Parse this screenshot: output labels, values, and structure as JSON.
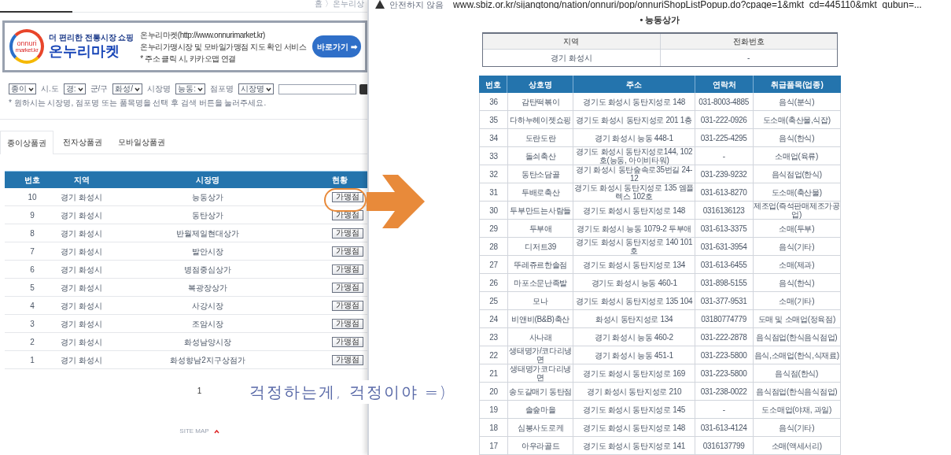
{
  "address_bar": {
    "security": "안전하지 않음",
    "url": "www.sbiz.or.kr/sijangtong/nation/onnuri/pop/onnuriShopListPopup.do?cpage=1&mkt_cd=445110&mkt_gubun=..."
  },
  "left_page": {
    "breadcrumb": "홈 〉온누리상",
    "banner": {
      "logo_text": [
        "onnuri",
        "market.kr"
      ],
      "tagline": "더 편리한 전통시장 쇼핑",
      "brand": "온누리마켓",
      "lines": [
        "온누리마켓(http://www.onnurimarket.kr)",
        "온누리가맹시장 및 모바일가맹점 지도 확인 서비스",
        "* 주소 클릭 시, 카카오맵 연결"
      ],
      "button": "바로가기 ➡"
    },
    "filters": [
      {
        "kind": "select",
        "value": "종이"
      },
      {
        "kind": "label",
        "text": "시.도"
      },
      {
        "kind": "select",
        "value": "경:"
      },
      {
        "kind": "label",
        "text": "군/구"
      },
      {
        "kind": "select",
        "value": "화성/"
      },
      {
        "kind": "label",
        "text": "시장명"
      },
      {
        "kind": "select",
        "value": "능동:"
      },
      {
        "kind": "label",
        "text": "점포명"
      },
      {
        "kind": "select",
        "value": "시장명"
      },
      {
        "kind": "input"
      }
    ],
    "note": "* 원하시는 시장명, 점포명 또는 품목명을 선택 후 검색 버튼을 눌러주세요.",
    "tabs": [
      {
        "label": "종이상품권",
        "selected": true
      },
      {
        "label": "전자상품권",
        "selected": false
      },
      {
        "label": "모바일상품권",
        "selected": false
      }
    ],
    "table": {
      "columns": [
        "번호",
        "지역",
        "시장명",
        "현황"
      ],
      "rows": [
        [
          "10",
          "경기 화성시",
          "능동상가",
          "가맹점"
        ],
        [
          "9",
          "경기 화성시",
          "동탄상가",
          "가맹점"
        ],
        [
          "8",
          "경기 화성시",
          "반월제일현대상가",
          "가맹점"
        ],
        [
          "7",
          "경기 화성시",
          "발안시장",
          "가맹점"
        ],
        [
          "6",
          "경기 화성시",
          "병점중심상가",
          "가맹점"
        ],
        [
          "5",
          "경기 화성시",
          "복광장상가",
          "가맹점"
        ],
        [
          "4",
          "경기 화성시",
          "사강시장",
          "가맹점"
        ],
        [
          "3",
          "경기 화성시",
          "조암시장",
          "가맹점"
        ],
        [
          "2",
          "경기 화성시",
          "화성남양시장",
          "가맹점"
        ],
        [
          "1",
          "경기 화성시",
          "화성향남2지구상점가",
          "가맹점"
        ]
      ]
    },
    "pagination": [
      "1"
    ],
    "footer": "SITE MAP"
  },
  "popup": {
    "title": "• 능동상가",
    "info": {
      "columns": [
        "지역",
        "전화번호"
      ],
      "values": [
        "경기 화성시",
        "-"
      ]
    },
    "shops": {
      "columns": [
        "번호",
        "상호명",
        "주소",
        "연락처",
        "취급품목(업종)"
      ],
      "rows": [
        [
          "36",
          "감탄떡볶이",
          "경기도 화성시 동탄지성로 148",
          "031-8003-4885",
          "음식(분식)"
        ],
        [
          "35",
          "다하누헤이젯쇼핑",
          "경기도 화성시 동탄지성로 201 1층",
          "031-222-0926",
          "도소매(축산물,식잡)"
        ],
        [
          "34",
          "도란도란",
          "경기 화성시 능동 448-1",
          "031-225-4295",
          "음식(한식)"
        ],
        [
          "33",
          "돌쇠축산",
          "경기도 화성시 동탄지성로144, 102호(능동, 아이비타워)",
          "-",
          "소매업(육류)"
        ],
        [
          "32",
          "동탄소담골",
          "경기 화성시 동탄숲속로35번길 24-12",
          "031-239-9232",
          "음식점업(한식)"
        ],
        [
          "31",
          "두배로축산",
          "경기도 화성시 동탄지성로 135 엠플렉스 102호",
          "031-613-8270",
          "도소매(축산물)"
        ],
        [
          "30",
          "두부만드는사람들",
          "경기도 화성시 동탄지성로 148",
          "0316136123",
          "제조업(즉석판매제조가공업)"
        ],
        [
          "29",
          "두부애",
          "경기도 화성시 능동 1079-2 두부애",
          "031-613-3375",
          "소매(두부)"
        ],
        [
          "28",
          "디저트39",
          "경기도 화성시 동탄지성로 140 101호",
          "031-631-3954",
          "음식(기타)"
        ],
        [
          "27",
          "뚜레쥬르한솔점",
          "경기도 화성시 동탄지성로 134",
          "031-613-6455",
          "소매(제과)"
        ],
        [
          "26",
          "마포소문난족발",
          "경기도 화성시 능동 460-1",
          "031-898-5155",
          "음식(한식)"
        ],
        [
          "25",
          "모나",
          "경기도 화성시 동탄지성로 135 104",
          "031-377-9531",
          "소매(기타)"
        ],
        [
          "24",
          "비앤비(B&B)축산",
          "화성시 동탄지성로 134",
          "03180774779",
          "도매 및 소매업(정육점)"
        ],
        [
          "23",
          "사나래",
          "경기 화성시 능동 460-2",
          "031-222-2878",
          "음식점업(한식음식점업)"
        ],
        [
          "22",
          "생태명가/코다리냉면",
          "경기 화성시 능동 451-1",
          "031-223-5800",
          "음식,소매업(한식,식재료)"
        ],
        [
          "21",
          "생태명가코다리냉면",
          "경기도 화성시 동탄지성로 169",
          "031-223-5800",
          "음식점(한식)"
        ],
        [
          "20",
          "송도갈매기 동탄점",
          "경기 화성시 동탄지성로 210",
          "031-238-0022",
          "음식점업(한식음식점업)"
        ],
        [
          "19",
          "솔숲마을",
          "경기도 화성시 동탄지성로 145",
          "-",
          "도소매업(야채, 과일)"
        ],
        [
          "18",
          "심봉사도로케",
          "경기도 화성시 동탄지성로 148",
          "031-613-4124",
          "음식(기타)"
        ],
        [
          "17",
          "아우라골드",
          "경기도 화성시 동탄지성로 141",
          "0316137799",
          "소매(액세서리)"
        ]
      ]
    }
  },
  "annotation": {
    "caption": "걱정하는게, 걱정이야 =)"
  }
}
